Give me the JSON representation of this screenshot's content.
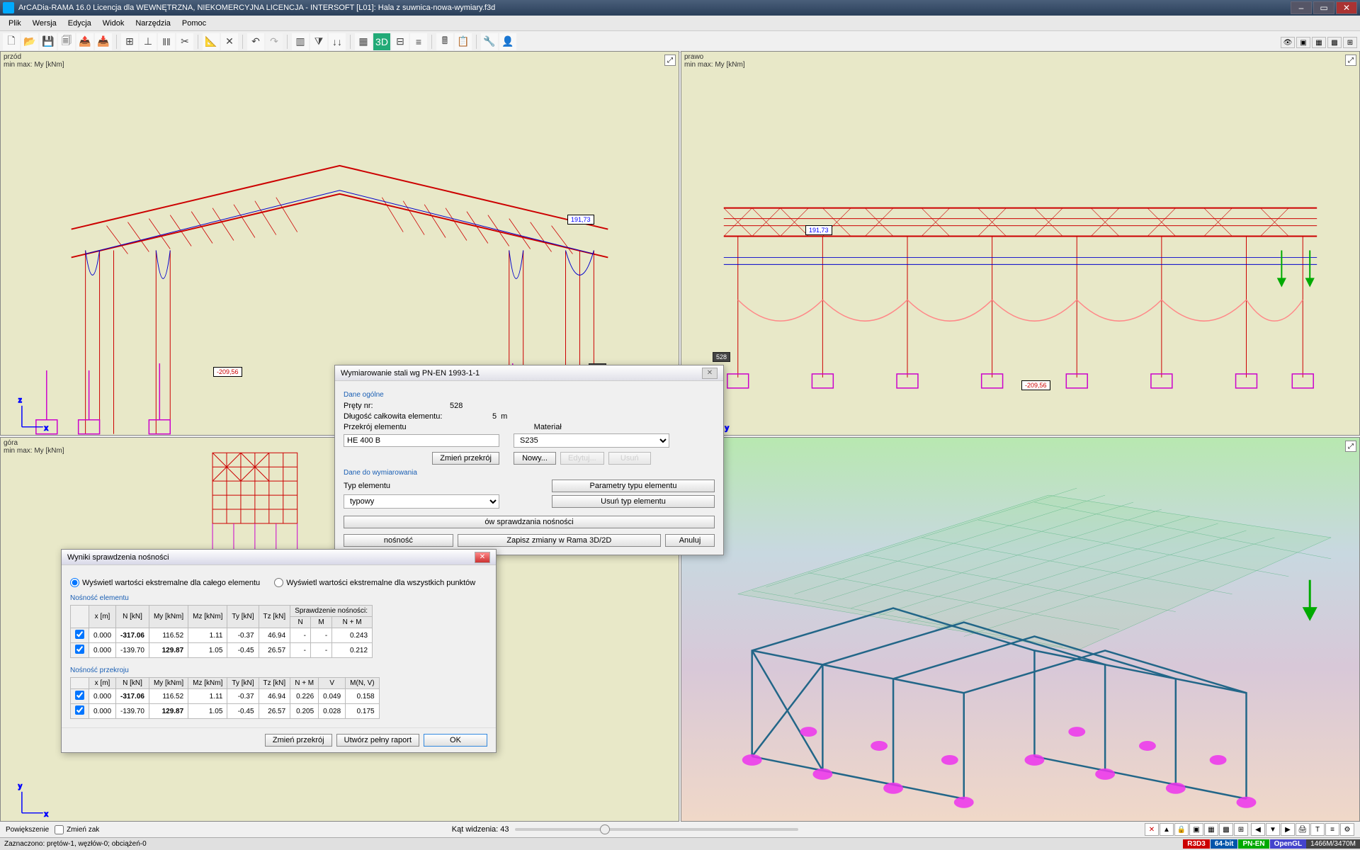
{
  "titlebar": {
    "text": "ArCADia-RAMA 16.0 Licencja dla WEWNĘTRZNA, NIEKOMERCYJNA LICENCJA - INTERSOFT [L01]: Hala z suwnica-nowa-wymiary.f3d"
  },
  "menu": [
    "Plik",
    "Wersja",
    "Edycja",
    "Widok",
    "Narzędzia",
    "Pomoc"
  ],
  "viewports": {
    "v1": {
      "name": "przód",
      "sub": "min max: My [kNm]"
    },
    "v2": {
      "name": "prawo",
      "sub": "min max: My [kNm]"
    },
    "v3": {
      "name": "góra",
      "sub": "min max: My [kNm]"
    },
    "v4": {
      "name": ""
    }
  },
  "annotations": {
    "pos_val": "191,73",
    "neg_val": "-209,56",
    "bar_val": "528"
  },
  "bottom": {
    "zoom_label": "Powiększenie",
    "zmien_label": "Zmień zak",
    "angle_label": "Kąt widzenia: 43"
  },
  "status": {
    "text": "Zaznaczono: prętów-1, węzłów-0; obciążeń-0",
    "r3d3": "R3D3",
    "bit": "64-bit",
    "pnen": "PN-EN",
    "gl": "OpenGL",
    "mem": "1466M/3470M"
  },
  "dlg1": {
    "title": "Wymiarowanie stali wg PN-EN 1993-1-1",
    "sec1": "Dane ogólne",
    "prety_lbl": "Pręty nr:",
    "prety_val": "528",
    "dlugosc_lbl": "Długość całkowita elementu:",
    "dlugosc_val": "5",
    "dlugosc_unit": "m",
    "przekroj_lbl": "Przekrój elementu",
    "przekroj_val": "HE 400 B",
    "material_lbl": "Materiał",
    "material_val": "S235",
    "btn_zmien": "Zmień przekrój",
    "btn_nowy": "Nowy...",
    "btn_edytuj": "Edytuj...",
    "btn_usun": "Usuń",
    "sec2": "Dane do wymiarowania",
    "typ_lbl": "Typ elementu",
    "typ_val": "typowy",
    "btn_param": "Parametry typu elementu",
    "btn_usuntyp": "Usuń typ elementu",
    "btn_lista": "ów sprawdzania nośności",
    "btn_nosnosc": "nośność",
    "btn_zapisz": "Zapisz zmiany w Rama 3D/2D",
    "btn_anuluj": "Anuluj"
  },
  "dlg2": {
    "title": "Wyniki sprawdzenia nośności",
    "radio1": "Wyświetl wartości ekstremalne dla całego elementu",
    "radio2": "Wyświetl wartości ekstremalne dla wszystkich punktów",
    "sec1": "Nośność elementu",
    "sec2": "Nośność przekroju",
    "headers_common": [
      "x [m]",
      "N [kN]",
      "My [kNm]",
      "Mz [kNm]",
      "Ty [kN]",
      "Tz [kN]"
    ],
    "header_spraw": "Sprawdzenie nośności:",
    "headers_nm": [
      "N",
      "M",
      "N + M"
    ],
    "headers_nmv": [
      "N + M",
      "V",
      "M(N, V)"
    ],
    "rows1": [
      {
        "x": "0.000",
        "N": "-317.06",
        "My": "116.52",
        "Mz": "1.11",
        "Ty": "-0.37",
        "Tz": "46.94",
        "a": "-",
        "b": "-",
        "c": "0.243",
        "bold": [
          "N"
        ]
      },
      {
        "x": "0.000",
        "N": "-139.70",
        "My": "129.87",
        "Mz": "1.05",
        "Ty": "-0.45",
        "Tz": "26.57",
        "a": "-",
        "b": "-",
        "c": "0.212",
        "bold": [
          "My"
        ]
      }
    ],
    "rows2": [
      {
        "x": "0.000",
        "N": "-317.06",
        "My": "116.52",
        "Mz": "1.11",
        "Ty": "-0.37",
        "Tz": "46.94",
        "a": "0.226",
        "b": "0.049",
        "c": "0.158",
        "bold": [
          "N"
        ]
      },
      {
        "x": "0.000",
        "N": "-139.70",
        "My": "129.87",
        "Mz": "1.05",
        "Ty": "-0.45",
        "Tz": "26.57",
        "a": "0.205",
        "b": "0.028",
        "c": "0.175",
        "bold": [
          "My"
        ]
      }
    ],
    "btn_zmien": "Zmień przekrój",
    "btn_raport": "Utwórz pełny raport",
    "btn_ok": "OK"
  }
}
